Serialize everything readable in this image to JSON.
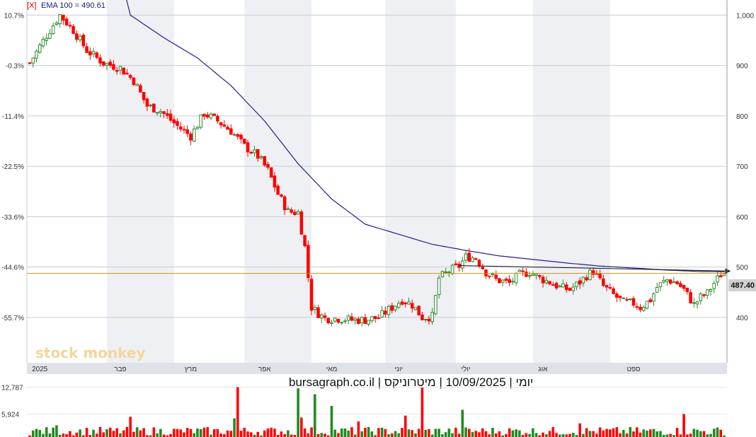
{
  "legend": {
    "close_marker": "[X]",
    "ema_text": "EMA 100 = 490.61"
  },
  "caption": "יומי | 10/09/2025 | מיטרוניקס | bursagraph.co.il",
  "watermark": "stock monkey",
  "last_price_label": "487.40",
  "colors": {
    "up": "#2e8b2e",
    "down": "#ff0000",
    "ema": "#1f1f8f",
    "price_line": "#c8961e",
    "trend": "#111111",
    "band": "#eef0f4"
  },
  "chart_data": {
    "type": "candlestick",
    "ema_label": "EMA 100",
    "ema_value": 490.61,
    "last_close": 487.4,
    "right_axis_ticks": [
      "1,000",
      "900",
      "800",
      "700",
      "600",
      "500",
      "400"
    ],
    "right_axis_values": [
      1000,
      900,
      800,
      700,
      600,
      500,
      400
    ],
    "left_axis_ticks": [
      "10.7%",
      "-0.3%",
      "-11.4%",
      "-22.5%",
      "-33.6%",
      "-44.6%",
      "-55.7%"
    ],
    "x_labels": [
      "2025",
      "פבר",
      "מרץ",
      "אפר",
      "מאי",
      "יוני",
      "יולי",
      "אוג",
      "ספט"
    ],
    "ylim": [
      310,
      1030
    ],
    "volume_ticks": [
      "12,787",
      "5,924"
    ],
    "volume_tick_values": [
      12787,
      5924
    ],
    "volume_ylim": [
      0,
      16000
    ],
    "close_path": [
      [
        0,
        905
      ],
      [
        5,
        960
      ],
      [
        9,
        1000
      ],
      [
        13,
        970
      ],
      [
        17,
        930
      ],
      [
        22,
        905
      ],
      [
        27,
        895
      ],
      [
        31,
        870
      ],
      [
        35,
        820
      ],
      [
        39,
        810
      ],
      [
        44,
        780
      ],
      [
        48,
        760
      ],
      [
        52,
        805
      ],
      [
        56,
        790
      ],
      [
        60,
        770
      ],
      [
        64,
        740
      ],
      [
        68,
        720
      ],
      [
        71,
        692
      ],
      [
        74,
        645
      ],
      [
        77,
        610
      ],
      [
        80,
        608
      ],
      [
        82,
        540
      ],
      [
        84,
        420
      ],
      [
        86,
        408
      ],
      [
        88,
        398
      ],
      [
        92,
        398
      ],
      [
        96,
        395
      ],
      [
        100,
        395
      ],
      [
        104,
        400
      ],
      [
        108,
        420
      ],
      [
        111,
        435
      ],
      [
        114,
        425
      ],
      [
        117,
        400
      ],
      [
        120,
        402
      ],
      [
        122,
        478
      ],
      [
        125,
        492
      ],
      [
        128,
        502
      ],
      [
        130,
        520
      ],
      [
        133,
        518
      ],
      [
        136,
        490
      ],
      [
        139,
        475
      ],
      [
        143,
        468
      ],
      [
        146,
        485
      ],
      [
        149,
        490
      ],
      [
        152,
        478
      ],
      [
        155,
        470
      ],
      [
        158,
        460
      ],
      [
        161,
        455
      ],
      [
        164,
        470
      ],
      [
        166,
        483
      ],
      [
        168,
        492
      ],
      [
        171,
        462
      ],
      [
        174,
        445
      ],
      [
        177,
        430
      ],
      [
        180,
        428
      ],
      [
        182,
        420
      ],
      [
        185,
        435
      ],
      [
        187,
        460
      ],
      [
        190,
        475
      ],
      [
        193,
        468
      ],
      [
        195,
        455
      ],
      [
        198,
        425
      ],
      [
        200,
        440
      ],
      [
        202,
        448
      ],
      [
        204,
        468
      ],
      [
        206,
        485
      ],
      [
        207,
        487.4
      ]
    ],
    "ema_path": [
      [
        27,
        1080
      ],
      [
        30,
        1000
      ],
      [
        40,
        955
      ],
      [
        50,
        915
      ],
      [
        60,
        860
      ],
      [
        70,
        790
      ],
      [
        80,
        705
      ],
      [
        90,
        635
      ],
      [
        100,
        585
      ],
      [
        110,
        565
      ],
      [
        120,
        545
      ],
      [
        130,
        533
      ],
      [
        140,
        522
      ],
      [
        150,
        515
      ],
      [
        160,
        508
      ],
      [
        170,
        502
      ],
      [
        180,
        498
      ],
      [
        190,
        494
      ],
      [
        200,
        491
      ],
      [
        207,
        490.61
      ]
    ],
    "trendline": [
      [
        128,
        503
      ],
      [
        208,
        492
      ]
    ],
    "volume_peaks": [
      [
        8,
        3000
      ],
      [
        30,
        5200
      ],
      [
        61,
        4800
      ],
      [
        62,
        12800
      ],
      [
        80,
        12500
      ],
      [
        81,
        5000
      ],
      [
        85,
        11000
      ],
      [
        90,
        8000
      ],
      [
        98,
        4000
      ],
      [
        112,
        5500
      ],
      [
        117,
        12700
      ],
      [
        129,
        7000
      ],
      [
        164,
        3500
      ],
      [
        195,
        5900
      ]
    ],
    "num_bars": 208
  }
}
